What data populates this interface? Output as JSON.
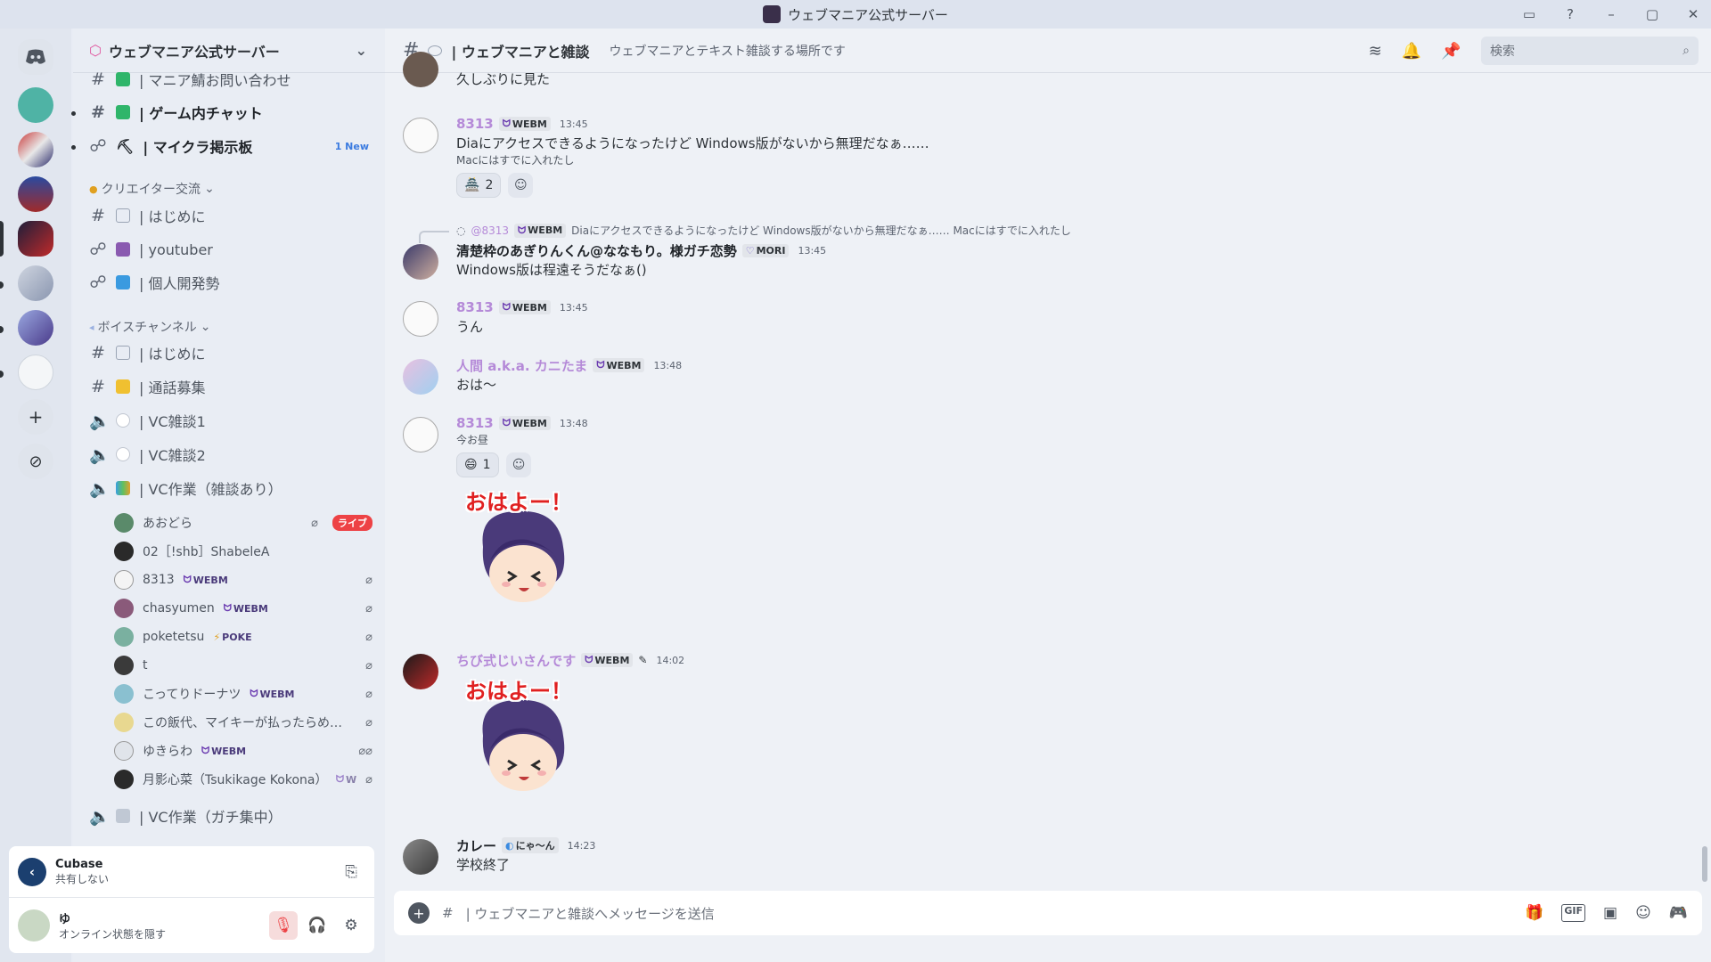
{
  "window": {
    "title": "ウェブマニア公式サーバー"
  },
  "rail": {
    "home_icon": "discord-logo-icon",
    "add_label": "+",
    "explore_icon": "compass-icon"
  },
  "sidebar": {
    "server_name": "ウェブマニア公式サーバー",
    "channels_top": [
      {
        "name": "| マニア鯖お問い合わせ",
        "bold": false
      },
      {
        "name": "| ゲーム内チャット",
        "bold": true
      },
      {
        "name": "| マイクラ掲示板",
        "bold": true,
        "tag": "1 New"
      }
    ],
    "cat_creator": "クリエイター交流",
    "creator_channels": [
      {
        "name": "| はじめに"
      },
      {
        "name": "| youtuber"
      },
      {
        "name": "| 個人開発勢"
      }
    ],
    "cat_voice": "ボイスチャンネル",
    "voice_channels": [
      {
        "name": "| はじめに"
      },
      {
        "name": "| 通話募集"
      },
      {
        "name": "| VC雑談1"
      },
      {
        "name": "| VC雑談2"
      },
      {
        "name": "| VC作業（雑談あり）"
      }
    ],
    "vc_users": [
      {
        "name": "あおどら",
        "badge": "",
        "live": "ライブ"
      },
      {
        "name": "02［!shb］ShabeleA",
        "badge": ""
      },
      {
        "name": "8313",
        "badge": "WEBM"
      },
      {
        "name": "chasyumen",
        "badge": "WEBM"
      },
      {
        "name": "poketetsu",
        "badge": "POKE"
      },
      {
        "name": "t",
        "badge": ""
      },
      {
        "name": "こってりドーナツ",
        "badge": "WEBM"
      },
      {
        "name": "この飯代、マイキーが払ったらめ…",
        "badge": ""
      },
      {
        "name": "ゆきらわ",
        "badge": "WEBM"
      },
      {
        "name": "月影心菜（Tsukikage Kokona）",
        "badge": "W"
      }
    ],
    "last_voice": "| VC作業（ガチ集中）"
  },
  "activity": {
    "app": "Cubase",
    "status": "共有しない"
  },
  "user": {
    "name": "ゆ",
    "status": "オンライン状態を隠す"
  },
  "header": {
    "channel": "| ウェブマニアと雑談",
    "topic": "ウェブマニアとテキスト雑談する場所です",
    "search_placeholder": "検索"
  },
  "messages": {
    "m0": {
      "text": "久しぶりに見た"
    },
    "m1": {
      "author": "8313",
      "tag": "WEBM",
      "time": "13:45",
      "text": "Diaにアクセスできるようになったけど Windows版がないから無理だなぁ……",
      "sub": "Macにはすでに入れたし",
      "react_count": "2"
    },
    "m2": {
      "reply_author": "@8313",
      "reply_tag": "WEBM",
      "reply_text": "Diaにアクセスできるようになったけど Windows版がないから無理だなぁ…… Macにはすでに入れたし",
      "author": "清楚枠のあぎりんくん@ななもり。様ガチ恋勢",
      "tag": "MORI",
      "time": "13:45",
      "text": "Windows版は程遠そうだなぁ()"
    },
    "m3": {
      "author": "8313",
      "tag": "WEBM",
      "time": "13:45",
      "text": "うん"
    },
    "m4": {
      "author": "人間 a.k.a. カニたま",
      "tag": "WEBM",
      "time": "13:48",
      "text": "おは〜"
    },
    "m5": {
      "author": "8313",
      "tag": "WEBM",
      "time": "13:48",
      "sub": "今お昼",
      "react_count": "1",
      "sticker_text": "おはよー！"
    },
    "m6": {
      "author": "ちび式じいさんです",
      "tag": "WEBM",
      "time": "14:02",
      "sticker_text": "おはよー！"
    },
    "m7": {
      "author": "カレー",
      "tag": "にゃ〜ん",
      "time": "14:23",
      "text": "学校終了"
    }
  },
  "composer": {
    "placeholder": "| ウェブマニアと雑談へメッセージを送信",
    "gif": "GIF"
  }
}
